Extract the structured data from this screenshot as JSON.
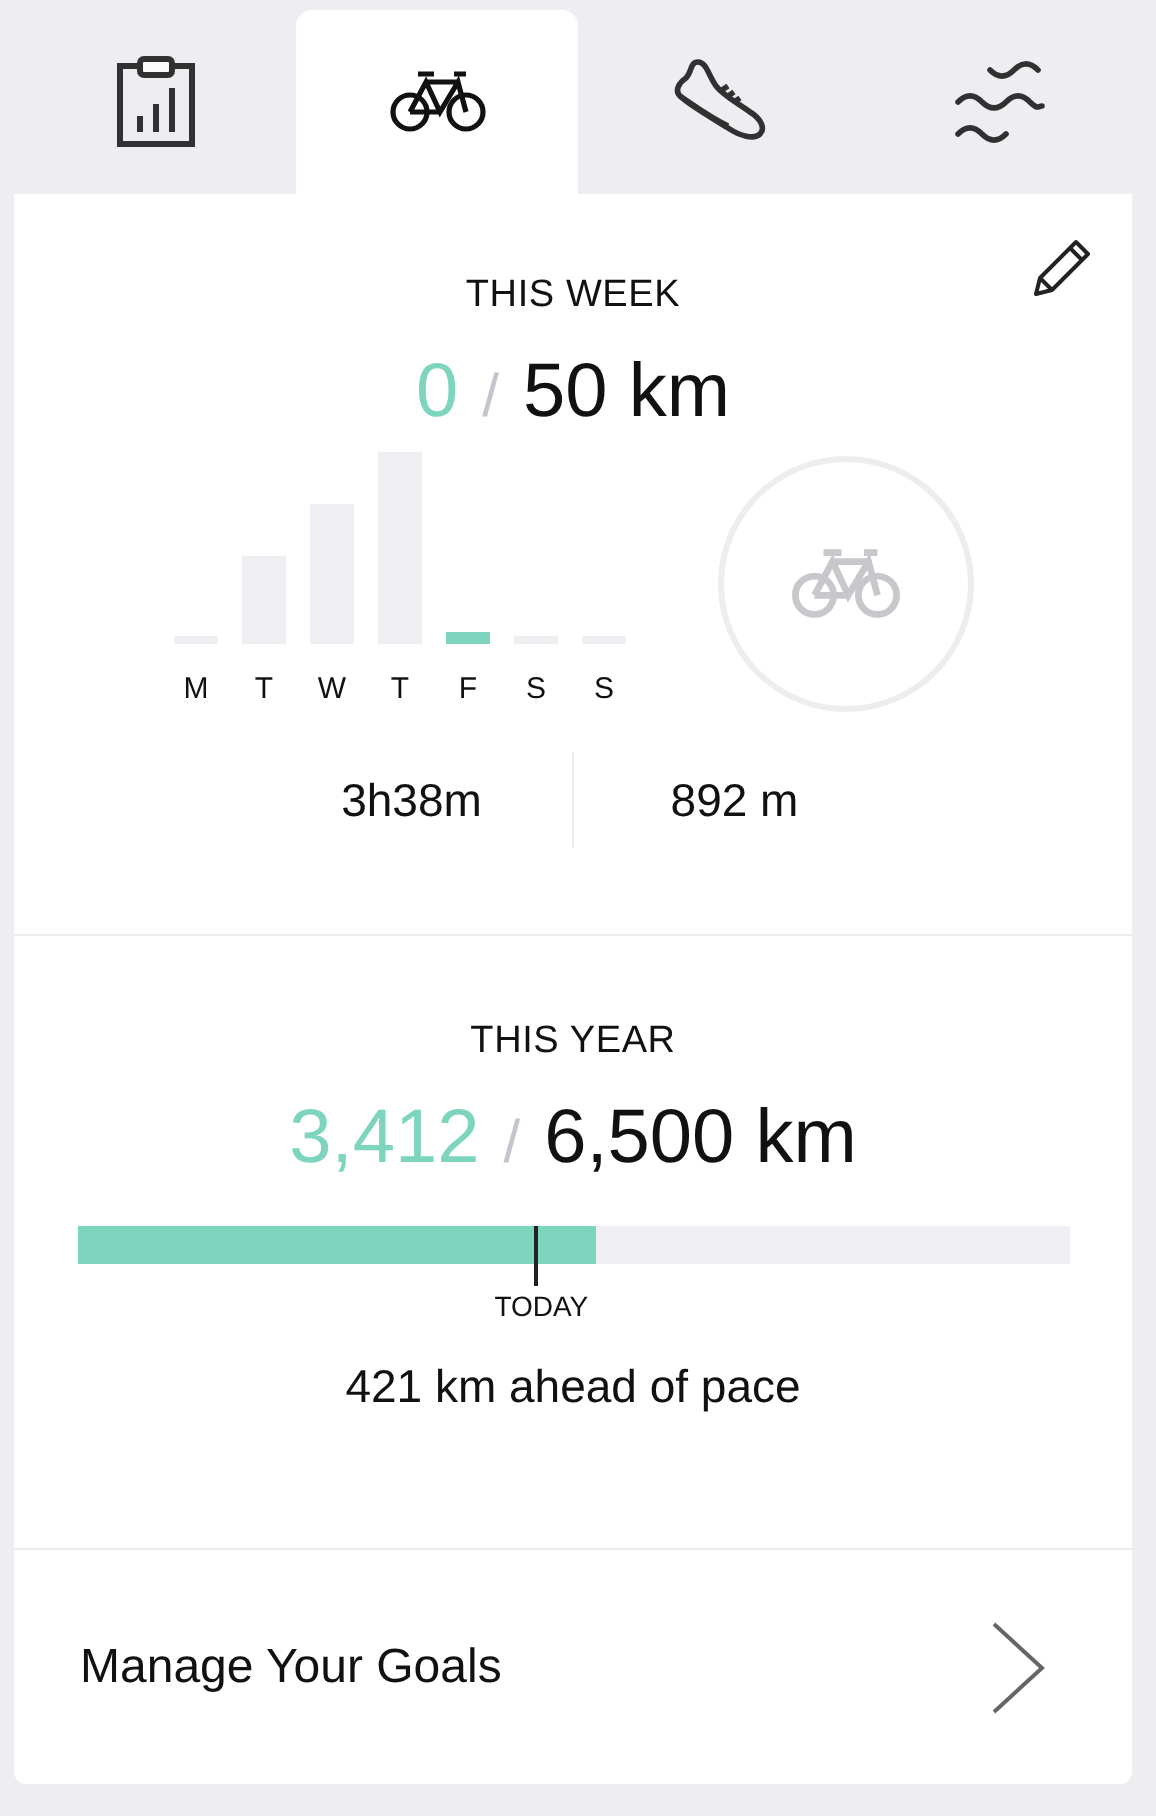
{
  "tabs": [
    {
      "kind": "clipboard",
      "selected": false
    },
    {
      "kind": "bike",
      "selected": true
    },
    {
      "kind": "shoe",
      "selected": false
    },
    {
      "kind": "waves",
      "selected": false
    }
  ],
  "week": {
    "title": "THIS WEEK",
    "current": "0",
    "separator": "/",
    "goal": "50 km",
    "days": [
      {
        "label": "M",
        "selected": false
      },
      {
        "label": "T",
        "selected": false
      },
      {
        "label": "W",
        "selected": false
      },
      {
        "label": "T",
        "selected": false
      },
      {
        "label": "F",
        "selected": true
      },
      {
        "label": "S",
        "selected": false
      },
      {
        "label": "S",
        "selected": false
      }
    ],
    "stats": [
      "3h38m",
      "892 m"
    ]
  },
  "year": {
    "title": "THIS YEAR",
    "current": "3,412",
    "separator": "/",
    "goal": "6,500 km",
    "progress": {
      "level": 0.524
    },
    "marker": {
      "label": "TODAY",
      "level": 0.46
    },
    "pace": "421 km ahead of pace"
  },
  "manage": {
    "label": "Manage Your Goals"
  }
}
